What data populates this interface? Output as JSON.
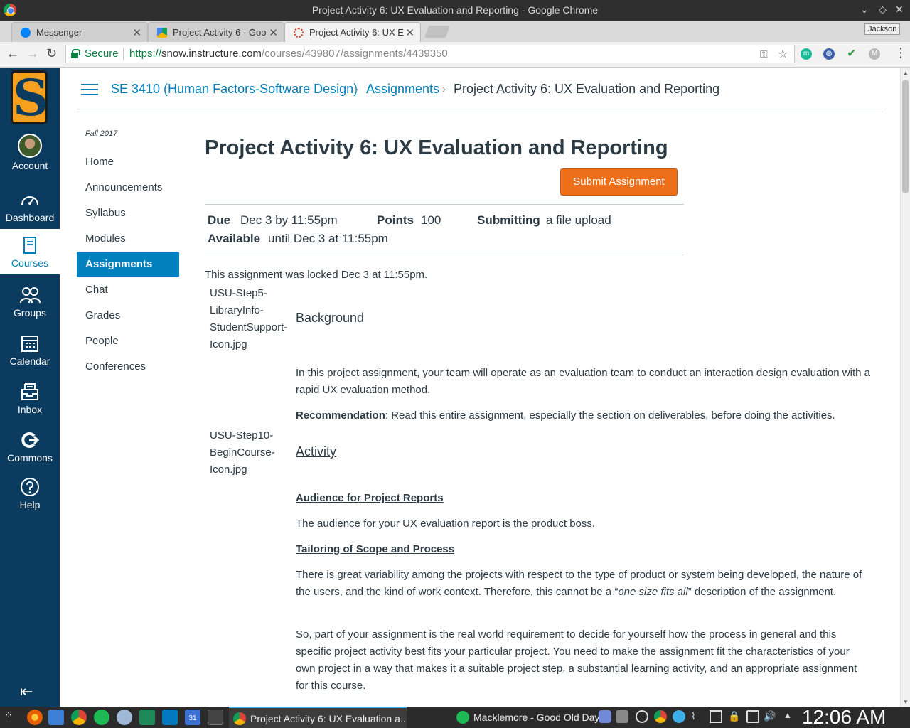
{
  "window": {
    "title": "Project Activity 6: UX Evaluation and Reporting - Google Chrome"
  },
  "tabs": [
    {
      "label": "Messenger"
    },
    {
      "label": "Project Activity 6 - Goo"
    },
    {
      "label": "Project Activity 6: UX E"
    }
  ],
  "profile": "Jackson",
  "omnibox": {
    "secure_label": "Secure",
    "url_scheme": "https://",
    "url_host": "snow.instructure.com",
    "url_path": "/courses/439807/assignments/4439350"
  },
  "global_nav": {
    "account": "Account",
    "dashboard": "Dashboard",
    "courses": "Courses",
    "groups": "Groups",
    "calendar": "Calendar",
    "inbox": "Inbox",
    "commons": "Commons",
    "help": "Help",
    "logo_letter": "S"
  },
  "breadcrumb": {
    "course": "SE 3410 (Human Factors-Software Design)",
    "section": "Assignments",
    "current": "Project Activity 6: UX Evaluation and Reporting",
    "separator": "›"
  },
  "course_nav": {
    "term": "Fall 2017",
    "items": [
      "Home",
      "Announcements",
      "Syllabus",
      "Modules",
      "Assignments",
      "Chat",
      "Grades",
      "People",
      "Conferences"
    ]
  },
  "assignment": {
    "title": "Project Activity 6: UX Evaluation and Reporting",
    "submit_label": "Submit Assignment",
    "due_label": "Due",
    "due_value": "Dec 3 by 11:55pm",
    "points_label": "Points",
    "points_value": "100",
    "submitting_label": "Submitting",
    "submitting_value": "a file upload",
    "available_label": "Available",
    "available_value": "until Dec 3 at 11:55pm",
    "locked_message": "This assignment was locked Dec 3 at 11:55pm."
  },
  "body": {
    "img1_lines": [
      "USU-Step5-",
      "LibraryInfo-",
      "StudentSupport-",
      "Icon.jpg"
    ],
    "background_heading": "Background",
    "background_text": "In this project assignment, your team will operate as an evaluation team to conduct an interaction design evaluation with a rapid UX evaluation method.",
    "recommendation_label": "Recommendation",
    "recommendation_text": ": Read this entire assignment, especially the section on deliverables, before doing the activities.",
    "img2_lines": [
      "USU-Step10-",
      "BeginCourse-",
      "Icon.jpg"
    ],
    "activity_heading": "Activity",
    "audience_heading": "Audience for Project Reports",
    "audience_text": "The audience for your UX evaluation report is the product boss.",
    "tailoring_heading": "Tailoring of Scope and Process",
    "tailoring_text_a": "There is great variability among the projects with respect to the type of product or system being developed, the nature of the users, and the kind of work context. Therefore, this cannot be a “",
    "tailoring_text_em": "one size fits all",
    "tailoring_text_b": "” description of the assignment.",
    "so_text": "So, part of your assignment is the real world requirement to decide for yourself how the process in general and this specific project activity best fits your particular project. You need to make the assignment fit the characteristics of your own project in a way that makes it a suitable project step, a substantial learning activity, and an appropriate assignment for this course."
  },
  "taskbar": {
    "task1": "Project Activity 6: UX Evaluation a...",
    "task2": "Macklemore - Good Old Days",
    "clock": "12:06 AM"
  },
  "colors": {
    "nav_bg": "#0c3b60",
    "link": "#0081bd",
    "submit": "#ee6f1a",
    "logo": "#f5a11f"
  }
}
